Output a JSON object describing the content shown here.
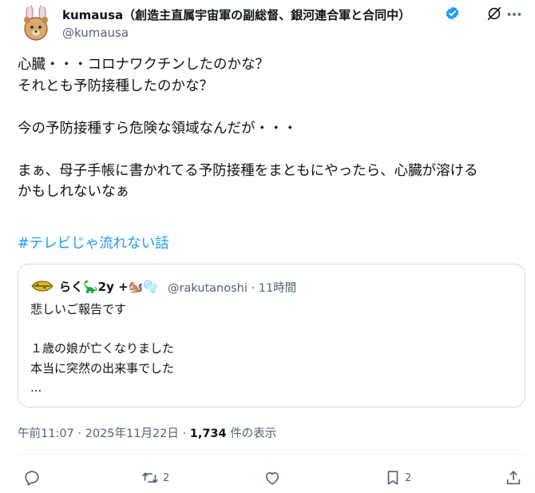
{
  "tweet": {
    "display_name": "kumausa（創造主直属宇宙軍の副総督、銀河連合軍と合同中）",
    "handle": "@kumausa",
    "body": "心臓・・・コロナワクチンしたのかな？\nそれとも予防接種したのかな？\n\n今の予防接種すら危険な領域なんだが・・・\n\nまぁ、母子手帳に書かれてる予防接種をまともにやったら、心臓が溶ける\nかもしれないなぁ",
    "hashtag": "#テレビじゃ流れない話",
    "timestamp": "午前11:07 · 2025年11月22日 · ",
    "views_count": "1,734",
    "views_label": " 件の表示"
  },
  "quote": {
    "display_name": "らく🦕2y +🐿️🫧",
    "handle_time": "@rakutanoshi · 11時間",
    "body": "悲しいご報告です\n\n１歳の娘が亡くなりました\n本当に突然の出来事でした\n..."
  },
  "actions": {
    "reply_count": "",
    "retweet_count": "2",
    "like_count": "",
    "bookmark_count": "2"
  },
  "colors": {
    "accent": "#1d9bf0",
    "muted": "#536471",
    "border": "#cfd9de"
  }
}
